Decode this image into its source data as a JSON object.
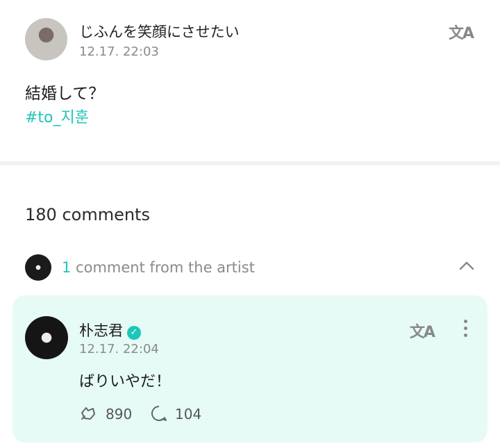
{
  "post": {
    "author": "じふんを笑顔にさせたい",
    "timestamp": "12.17. 22:03",
    "body": "結婚して？",
    "hashtag": "#to_지훈",
    "translate_glyph": "文A"
  },
  "comments": {
    "count_label": "180 comments",
    "artist_section": {
      "count": "1",
      "label": " comment from the artist"
    }
  },
  "artist_comment": {
    "author": "朴志君",
    "verified_glyph": "✓",
    "timestamp": "12.17. 22:04",
    "body": "ばりいやだ！",
    "likes": "890",
    "replies": "104",
    "translate_glyph": "文A"
  },
  "colors": {
    "accent": "#1ec6b7",
    "card_bg": "#e6fbf6"
  }
}
